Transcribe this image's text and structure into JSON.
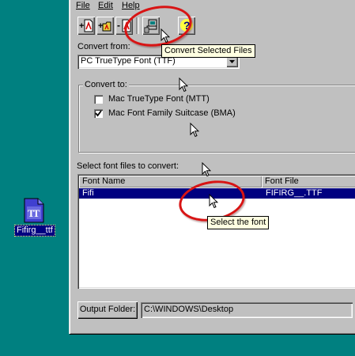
{
  "desktop": {
    "icon_label": "Fifirg__ttf",
    "icon_glyph": "TT"
  },
  "menu": {
    "file": "File",
    "edit": "Edit",
    "help": "Help"
  },
  "toolbar": {
    "tooltip": "Convert Selected Files",
    "help_glyph": "?"
  },
  "convert_from": {
    "label": "Convert from:",
    "selected": "PC TrueType Font (TTF)"
  },
  "convert_to": {
    "label": "Convert to:",
    "options": [
      {
        "label": "Mac TrueType Font (MTT)",
        "checked": false
      },
      {
        "label": "Mac Font Family Suitcase (BMA)",
        "checked": true
      }
    ]
  },
  "file_list": {
    "label": "Select font files to convert:",
    "columns": [
      "Font Name",
      "Font File"
    ],
    "rows": [
      {
        "name": "Fifi",
        "file": "FIFIRG__.TTF",
        "selected": true
      }
    ]
  },
  "annotation": {
    "select_font": "Select the font"
  },
  "output": {
    "button_label": "Output Folder:",
    "path": "C:\\WINDOWS\\Desktop"
  },
  "colors": {
    "desktop": "#008080",
    "window_face": "#c0c0c0",
    "selection": "#000080",
    "tooltip_bg": "#ffffe1",
    "highlight_ring": "#d81414"
  }
}
